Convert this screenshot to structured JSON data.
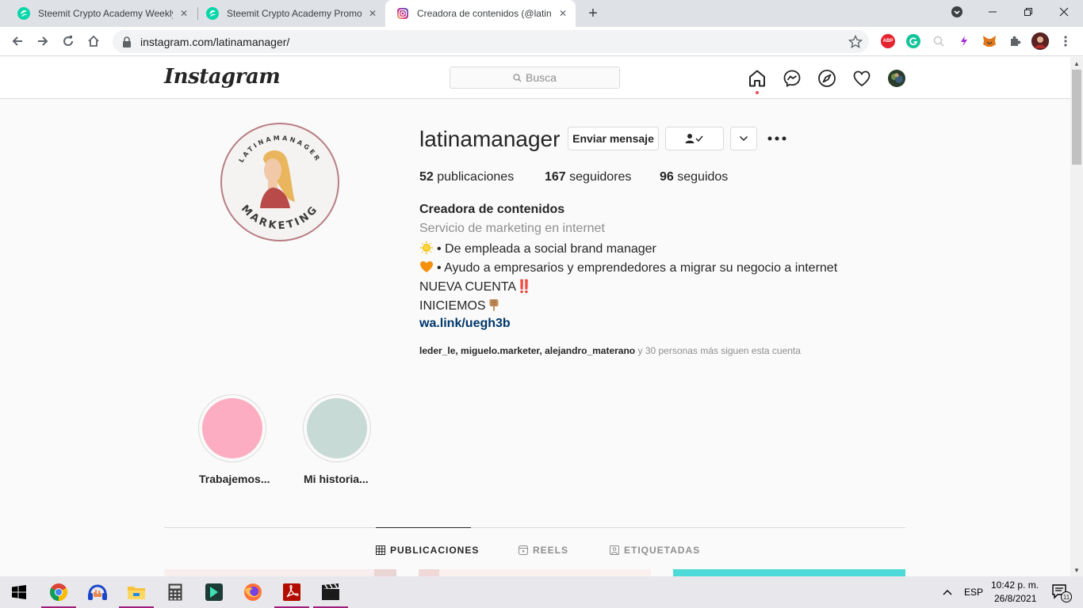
{
  "browser": {
    "tabs": [
      {
        "title": "Steemit Crypto Academy Weekly",
        "icon": "steemit-icon",
        "active": false
      },
      {
        "title": "Steemit Crypto Academy Promot",
        "icon": "steemit-icon",
        "active": false
      },
      {
        "title": "Creadora de contenidos (@latina",
        "icon": "instagram-icon",
        "active": true
      }
    ],
    "new_tab": "+",
    "url": "instagram.com/latinamanager/",
    "extensions": [
      "abp-icon",
      "grammarly-icon",
      "search-ext-icon",
      "sync-icon",
      "metamask-icon",
      "puzzle-icon",
      "profile-avatar"
    ],
    "abp_label": "ABP"
  },
  "instagram": {
    "logo": "Instagram",
    "search_placeholder": "Busca",
    "nav_icons": [
      "home-icon",
      "messenger-icon",
      "explore-icon",
      "heart-icon",
      "profile-avatar"
    ],
    "profile": {
      "username": "latinamanager",
      "avatar_text_top": "LATINAMANAGER",
      "avatar_text_bottom": "MARKETING",
      "message_button": "Enviar mensaje",
      "follow_icon": "following-icon",
      "stats": {
        "posts_count": "52",
        "posts_label": "publicaciones",
        "followers_count": "167",
        "followers_label": "seguidores",
        "following_count": "96",
        "following_label": "seguidos"
      },
      "bio": {
        "name": "Creadora de contenidos",
        "category": "Servicio de marketing en internet",
        "line1": "• De empleada a social brand manager",
        "line2": "• Ayudo a empresarios y emprendedores a migrar su negocio a internet",
        "line3": "NUEVA CUENTA‼️",
        "line4": "INICIEMOS",
        "link": "wa.link/uegh3b"
      },
      "followed_by": {
        "names": [
          "leder_le",
          "miguelo.marketer",
          "alejandro_materano"
        ],
        "suffix": "y 30 personas más siguen esta cuenta"
      }
    },
    "highlights": [
      {
        "label": "Trabajemos...",
        "color": "#fcadc1"
      },
      {
        "label": "Mi historia...",
        "color": "#c8dad6"
      }
    ],
    "tabs": [
      {
        "label": "PUBLICACIONES",
        "icon": "grid-icon",
        "active": true
      },
      {
        "label": "REELS",
        "icon": "reels-icon",
        "active": false
      },
      {
        "label": "ETIQUETADAS",
        "icon": "tagged-icon",
        "active": false
      }
    ]
  },
  "taskbar": {
    "apps": [
      "windows-start-icon",
      "chrome-icon",
      "audacity-icon",
      "file-explorer-icon",
      "calculator-icon",
      "filmora-icon",
      "firefox-icon",
      "acrobat-icon",
      "video-editor-icon"
    ],
    "language": "ESP",
    "time": "10:42 p. m.",
    "date": "26/8/2021",
    "notifications_count": "11"
  },
  "colors": {
    "instagram_accent": "#ed4956",
    "link": "#00376b",
    "avatar_ring": "#b87d82"
  }
}
